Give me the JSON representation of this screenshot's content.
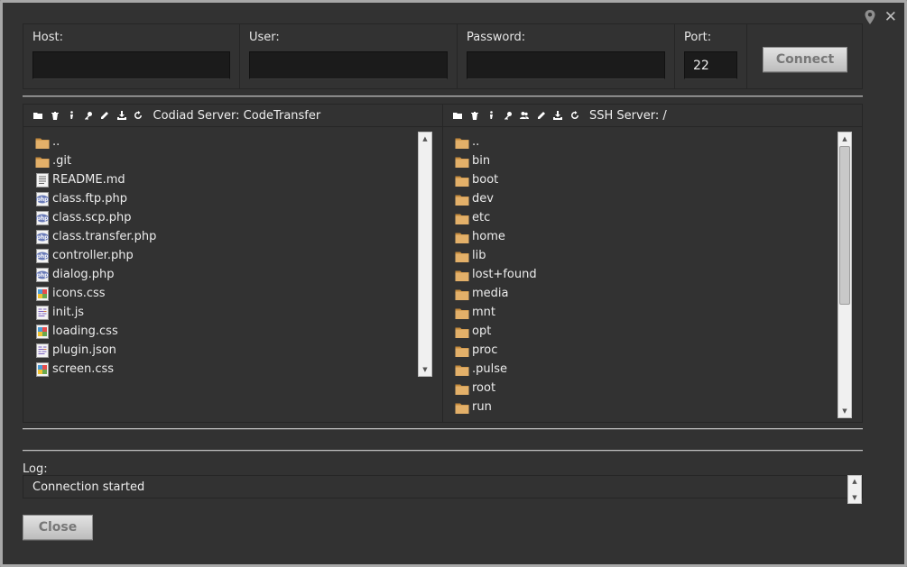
{
  "connection": {
    "host_label": "Host:",
    "host_value": "",
    "user_label": "User:",
    "user_value": "",
    "password_label": "Password:",
    "password_value": "",
    "port_label": "Port:",
    "port_value": "22",
    "connect_label": "Connect"
  },
  "local_panel": {
    "title": "Codiad Server: CodeTransfer",
    "toolbar_icons": [
      "folder-icon",
      "trash-icon",
      "info-icon",
      "key-icon",
      "pencil-icon",
      "download-icon",
      "refresh-icon"
    ],
    "files": [
      {
        "name": "..",
        "icon": "folder"
      },
      {
        "name": ".git",
        "icon": "folder"
      },
      {
        "name": "README.md",
        "icon": "text"
      },
      {
        "name": "class.ftp.php",
        "icon": "php"
      },
      {
        "name": "class.scp.php",
        "icon": "php"
      },
      {
        "name": "class.transfer.php",
        "icon": "php"
      },
      {
        "name": "controller.php",
        "icon": "php"
      },
      {
        "name": "dialog.php",
        "icon": "php"
      },
      {
        "name": "icons.css",
        "icon": "css"
      },
      {
        "name": "init.js",
        "icon": "code"
      },
      {
        "name": "loading.css",
        "icon": "css"
      },
      {
        "name": "plugin.json",
        "icon": "code"
      },
      {
        "name": "screen.css",
        "icon": "css"
      }
    ]
  },
  "remote_panel": {
    "title": "SSH Server: /",
    "toolbar_icons": [
      "folder-icon",
      "trash-icon",
      "info-icon",
      "key-icon",
      "users-icon",
      "pencil-icon",
      "download-icon",
      "refresh-icon"
    ],
    "files": [
      {
        "name": "..",
        "icon": "folder"
      },
      {
        "name": "bin",
        "icon": "folder"
      },
      {
        "name": "boot",
        "icon": "folder"
      },
      {
        "name": "dev",
        "icon": "folder"
      },
      {
        "name": "etc",
        "icon": "folder"
      },
      {
        "name": "home",
        "icon": "folder"
      },
      {
        "name": "lib",
        "icon": "folder"
      },
      {
        "name": "lost+found",
        "icon": "folder"
      },
      {
        "name": "media",
        "icon": "folder"
      },
      {
        "name": "mnt",
        "icon": "folder"
      },
      {
        "name": "opt",
        "icon": "folder"
      },
      {
        "name": "proc",
        "icon": "folder"
      },
      {
        "name": ".pulse",
        "icon": "folder"
      },
      {
        "name": "root",
        "icon": "folder"
      },
      {
        "name": "run",
        "icon": "folder"
      }
    ]
  },
  "log": {
    "label": "Log:",
    "text": "Connection started"
  },
  "close_label": "Close",
  "colors": {
    "background": "#323232",
    "folder": "#d9a85a",
    "button": "#d0d0d0"
  }
}
